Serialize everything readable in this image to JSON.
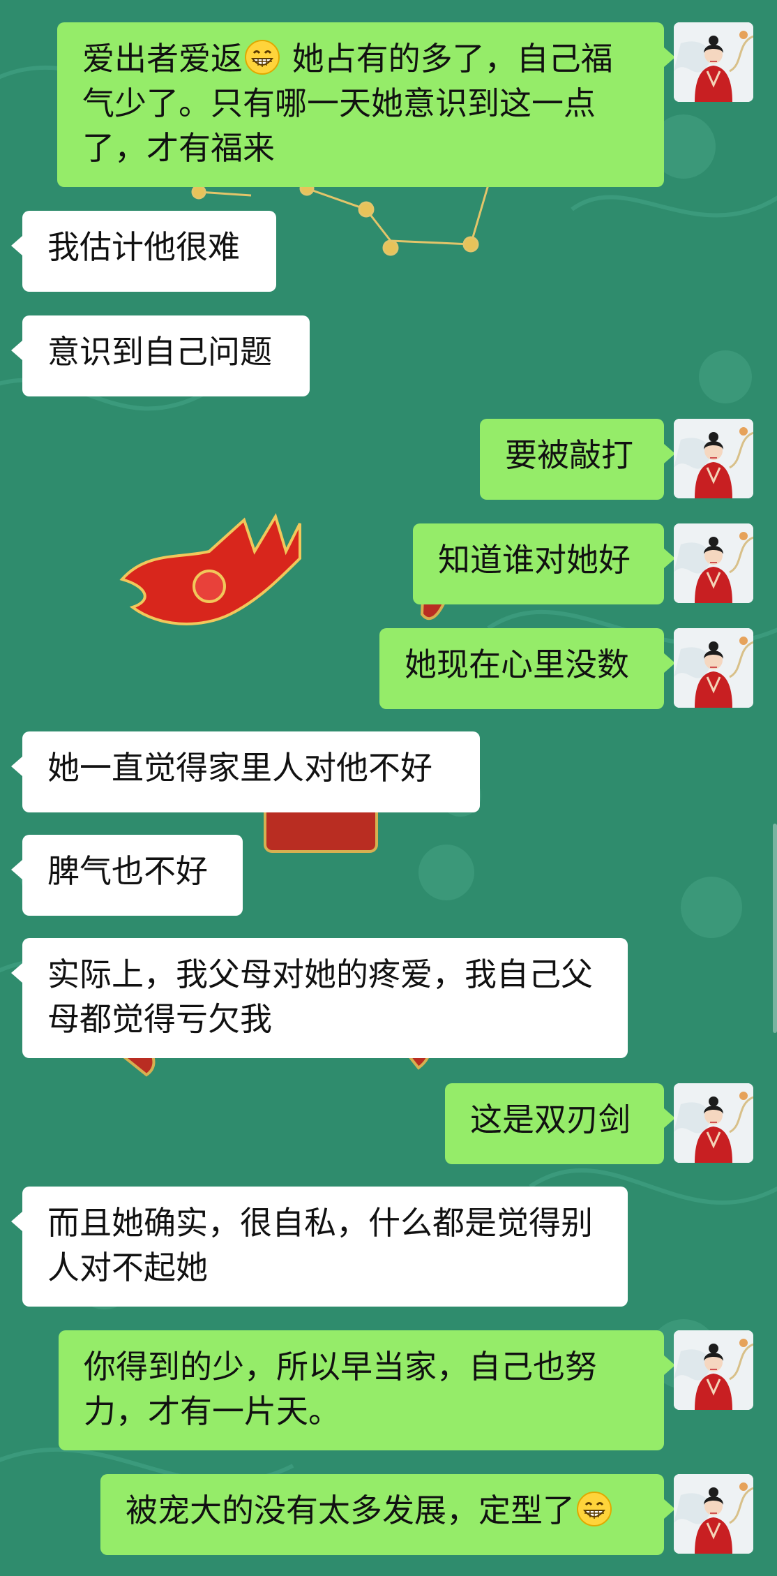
{
  "theme": {
    "background": "#2f8c6d",
    "incoming_bubble": "#ffffff",
    "outgoing_bubble": "#95ec69"
  },
  "messages": [
    {
      "id": "m1",
      "side": "out",
      "text_parts": [
        "爱出者爱返",
        "grin-emoji",
        " 她占有的多了，自己福气少了。只有哪一天她意识到这一点了，才有福来"
      ]
    },
    {
      "id": "m2",
      "side": "in",
      "text": "我估计他很难"
    },
    {
      "id": "m3",
      "side": "in",
      "text": "意识到自己问题"
    },
    {
      "id": "m4",
      "side": "out",
      "text": "要被敲打"
    },
    {
      "id": "m5",
      "side": "out",
      "text": "知道谁对她好"
    },
    {
      "id": "m6",
      "side": "out",
      "text": "她现在心里没数"
    },
    {
      "id": "m7",
      "side": "in",
      "text": "她一直觉得家里人对他不好"
    },
    {
      "id": "m8",
      "side": "in",
      "text": "脾气也不好"
    },
    {
      "id": "m9",
      "side": "in",
      "text": "实际上，我父母对她的疼爱，我自己父母都觉得亏欠我"
    },
    {
      "id": "m10",
      "side": "out",
      "text": "这是双刃剑"
    },
    {
      "id": "m11",
      "side": "in",
      "text": "而且她确实，很自私，什么都是觉得别人对不起她"
    },
    {
      "id": "m12",
      "side": "out",
      "text": "你得到的少，所以早当家，自己也努力，才有一片天。"
    },
    {
      "id": "m13",
      "side": "out",
      "text_parts": [
        "被宠大的没有太多发展，定型了",
        "grin-emoji",
        ""
      ]
    }
  ],
  "avatar_icon": "avatar-woman-red-hanfu-icon"
}
